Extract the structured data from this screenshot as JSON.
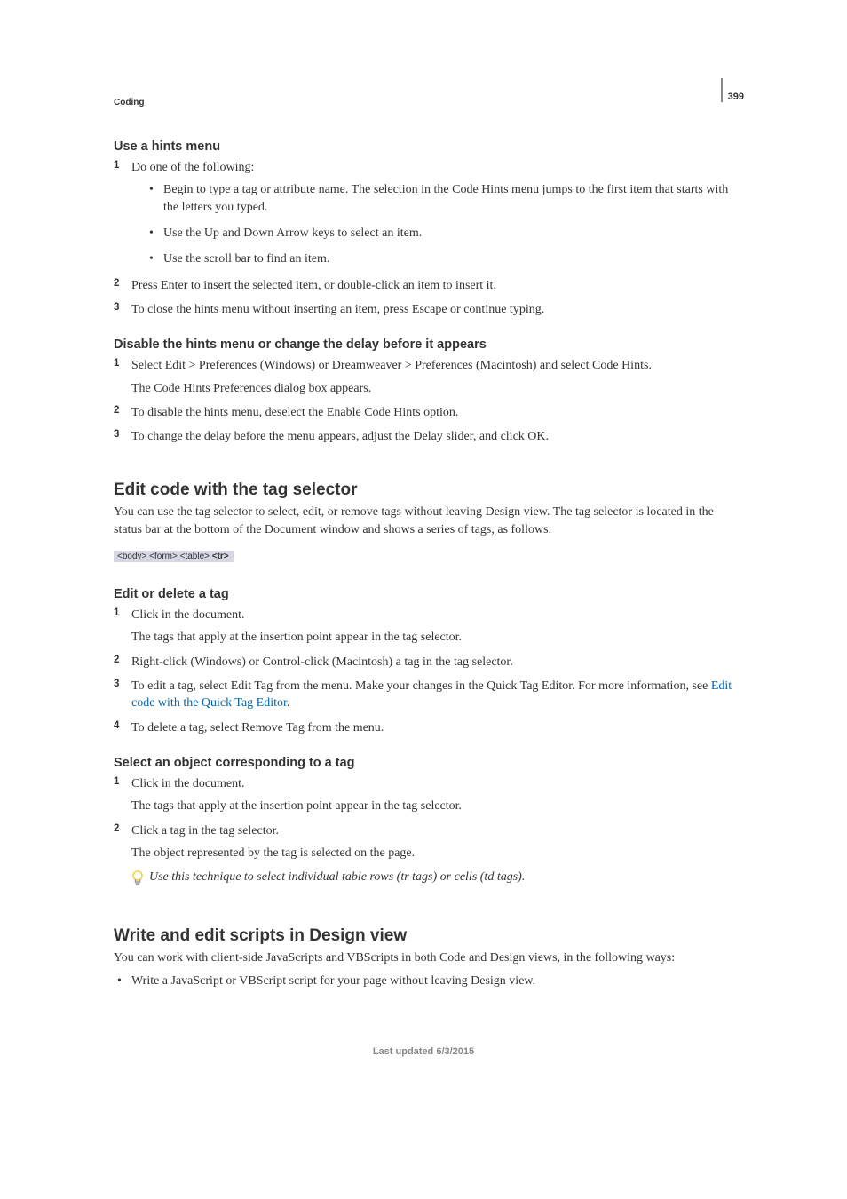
{
  "page_number": "399",
  "breadcrumb": "Coding",
  "h_hints": "Use a hints menu",
  "hints_steps": [
    {
      "n": "1",
      "text": "Do one of the following:",
      "bullets": [
        "Begin to type a tag or attribute name. The selection in the Code Hints menu jumps to the first item that starts with the letters you typed.",
        "Use the Up and Down Arrow keys to select an item.",
        "Use the scroll bar to find an item."
      ]
    },
    {
      "n": "2",
      "text": "Press Enter to insert the selected item, or double-click an item to insert it."
    },
    {
      "n": "3",
      "text": "To close the hints menu without inserting an item, press Escape or continue typing."
    }
  ],
  "h_disable": "Disable the hints menu or change the delay before it appears",
  "disable_steps": [
    {
      "n": "1",
      "text": "Select Edit > Preferences (Windows) or Dreamweaver > Preferences (Macintosh) and select Code Hints.",
      "follow": "The Code Hints Preferences dialog box appears."
    },
    {
      "n": "2",
      "text": "To disable the hints menu, deselect the Enable Code Hints option."
    },
    {
      "n": "3",
      "text": "To change the delay before the menu appears, adjust the Delay slider, and click OK."
    }
  ],
  "h_tagselector": "Edit code with the tag selector",
  "tagselector_intro": "You can use the tag selector to select, edit, or remove tags without leaving Design view. The tag selector is located in the status bar at the bottom of the Document window and shows a series of tags, as follows:",
  "tagbar_html": "<body> <form> <table> <tr>",
  "tagbar_part1": "<body> <form> <table>",
  "tagbar_active": "<tr>",
  "h_editdelete": "Edit or delete a tag",
  "editdelete_steps": [
    {
      "n": "1",
      "text": "Click in the document.",
      "follow": "The tags that apply at the insertion point appear in the tag selector."
    },
    {
      "n": "2",
      "text": "Right-click (Windows) or Control-click (Macintosh) a tag in the tag selector."
    },
    {
      "n": "3",
      "text_before": "To edit a tag, select Edit Tag from the menu. Make your changes in the Quick Tag Editor. For more information, see ",
      "link_text": "Edit code with the Quick Tag Editor",
      "text_after": "."
    },
    {
      "n": "4",
      "text": "To delete a tag, select Remove Tag from the menu."
    }
  ],
  "h_selectobj": "Select an object corresponding to a tag",
  "selectobj_steps": [
    {
      "n": "1",
      "text": "Click in the document.",
      "follow": "The tags that apply at the insertion point appear in the tag selector."
    },
    {
      "n": "2",
      "text": "Click a tag in the tag selector.",
      "follow": "The object represented by the tag is selected on the page."
    }
  ],
  "tip_text": "Use this technique to select individual table rows (tr tags) or cells (td tags).",
  "h_scripts": "Write and edit scripts in Design view",
  "scripts_intro": "You can work with client-side JavaScripts and VBScripts in both Code and Design views, in the following ways:",
  "scripts_bullets": [
    "Write a JavaScript or VBScript script for your page without leaving Design view."
  ],
  "footer": "Last updated 6/3/2015"
}
